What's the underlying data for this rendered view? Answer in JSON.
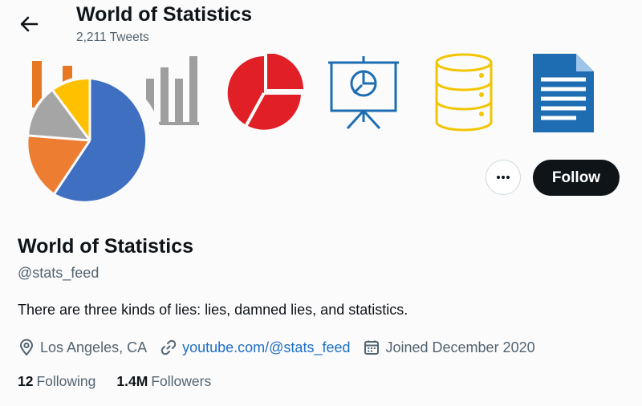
{
  "header": {
    "title": "World of Statistics",
    "tweet_count": "2,211 Tweets",
    "back_icon": "arrow-left-icon"
  },
  "banner": {
    "icons": [
      "bar-chart-icon",
      "bar-chart-icon",
      "pie-chart-icon",
      "presentation-board-icon",
      "database-icon",
      "document-icon"
    ],
    "colors": [
      "#e87722",
      "#9e9e9e",
      "#e01f26",
      "#1e6db3",
      "#f2c500",
      "#1e6db3"
    ]
  },
  "avatar": {
    "icon": "pie-chart-icon",
    "colors": [
      "#3e6fc1",
      "#ed7d31",
      "#a5a5a5",
      "#ffc000"
    ]
  },
  "actions": {
    "more_icon": "more-horizontal-icon",
    "follow_label": "Follow"
  },
  "profile": {
    "name": "World of Statistics",
    "handle": "@stats_feed",
    "bio": "There are three kinds of lies: lies, damned lies, and statistics.",
    "location": "Los Angeles, CA",
    "website": "youtube.com/@stats_feed",
    "joined": "Joined December 2020",
    "location_icon": "location-pin-icon",
    "link_icon": "link-icon",
    "calendar_icon": "calendar-icon"
  },
  "stats": {
    "following_count": "12",
    "following_label": "Following",
    "followers_count": "1.4M",
    "followers_label": "Followers"
  },
  "colors": {
    "text": "#0f1419",
    "secondary_text": "#536471",
    "link": "#1d6fc9",
    "follow_button_bg": "#0f1419",
    "follow_button_text": "#ffffff"
  }
}
